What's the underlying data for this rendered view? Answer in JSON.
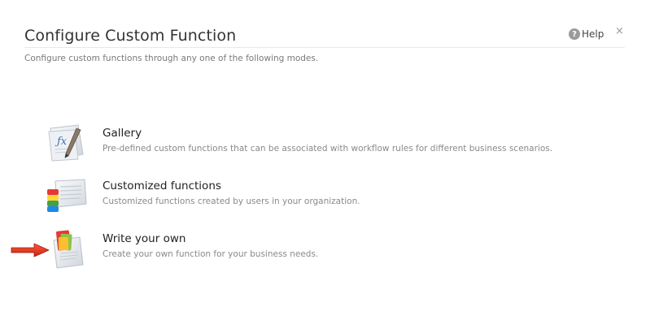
{
  "dialog": {
    "title": "Configure Custom Function",
    "subtitle": "Configure custom functions through any one of the following modes.",
    "help_label": "Help",
    "help_icon": "help-circle-icon",
    "close_glyph": "×"
  },
  "options": [
    {
      "title": "Gallery",
      "description": "Pre-defined custom functions that can be associated with workflow rules for different business scenarios.",
      "icon": "function-document-icon"
    },
    {
      "title": "Customized functions",
      "description": "Customized functions created by users in your organization.",
      "icon": "stacked-database-document-icon"
    },
    {
      "title": "Write your own",
      "description": "Create your own function for your business needs.",
      "icon": "write-document-icon"
    }
  ],
  "annotation": {
    "arrow_icon": "red-pointer-arrow-icon",
    "color": "#e0301e"
  }
}
